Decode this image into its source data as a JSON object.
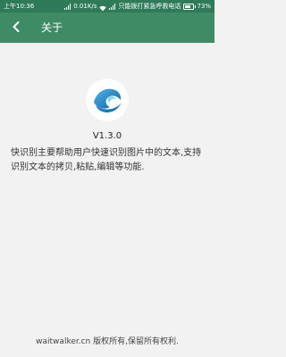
{
  "status_bar": {
    "time": "上午10:36",
    "network_speed": "0.01K/s",
    "carrier_text": "只能拨打紧急呼救电话",
    "battery_percent": "73%"
  },
  "app_bar": {
    "title": "关于"
  },
  "about": {
    "version": "V1.3.0",
    "description": "快识别主要帮助用户快速识别图片中的文本,支持识别文本的拷贝,粘贴,编辑等功能.",
    "footer": "waitwalker.cn 版权所有,保留所有权利."
  },
  "colors": {
    "status_bar_bg": "#2f7a58",
    "app_bar_bg": "#3f8b66",
    "page_bg": "#f2f2f2",
    "logo_blue": "#1e7fc2"
  },
  "icons": {
    "back": "chevron-left-icon",
    "logo": "wave-logo-icon",
    "signal": "signal-icon",
    "wifi": "wifi-icon",
    "battery": "battery-icon"
  }
}
